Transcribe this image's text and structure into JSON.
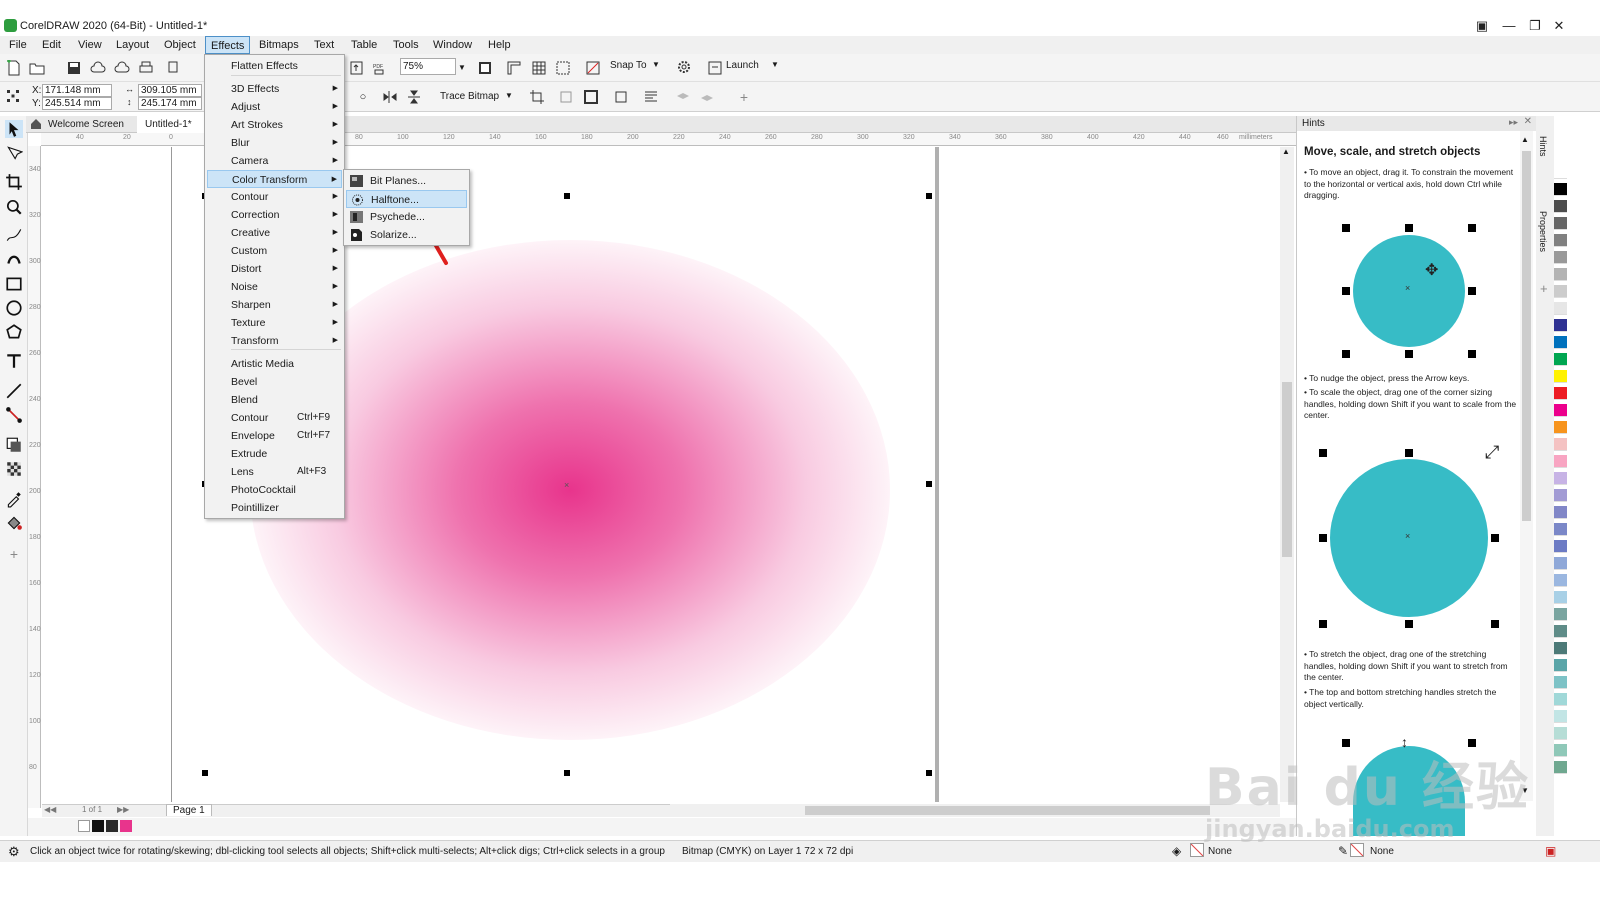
{
  "window": {
    "title": "CorelDRAW 2020 (64-Bit) - Untitled-1*"
  },
  "menubar": [
    "File",
    "Edit",
    "View",
    "Layout",
    "Object",
    "Effects",
    "Bitmaps",
    "Text",
    "Table",
    "Tools",
    "Window",
    "Help"
  ],
  "toolbar1": {
    "zoom": "75%",
    "snap_to": "Snap To",
    "launch": "Launch"
  },
  "toolbar2": {
    "x_label": "X:",
    "x": "171.148 mm",
    "y_label": "Y:",
    "y": "245.514 mm",
    "w": "309.105 mm",
    "h": "245.174 mm",
    "trace_bitmap": "Trace Bitmap"
  },
  "doc_tabs": [
    "Welcome Screen",
    "Untitled-1*"
  ],
  "ruler": {
    "h_ticks": [
      "40",
      "20",
      "0",
      "20",
      "40",
      "60",
      "80",
      "100",
      "120",
      "140",
      "160",
      "180",
      "200",
      "220",
      "240",
      "260",
      "280",
      "300",
      "320",
      "340",
      "360",
      "380",
      "400",
      "420",
      "440",
      "460"
    ],
    "unit": "millimeters",
    "v_ticks": [
      "340",
      "320",
      "300",
      "280",
      "260",
      "240",
      "220",
      "200",
      "180",
      "160",
      "140",
      "120",
      "100",
      "80",
      "60",
      "40",
      "20"
    ]
  },
  "effects_menu": {
    "items": [
      {
        "label": "Flatten Effects",
        "arrow": false
      },
      {
        "label": "3D Effects",
        "arrow": true
      },
      {
        "label": "Adjust",
        "arrow": true
      },
      {
        "label": "Art Strokes",
        "arrow": true
      },
      {
        "label": "Blur",
        "arrow": true
      },
      {
        "label": "Camera",
        "arrow": true
      },
      {
        "label": "Color Transform",
        "arrow": true
      },
      {
        "label": "Contour",
        "arrow": true
      },
      {
        "label": "Correction",
        "arrow": true
      },
      {
        "label": "Creative",
        "arrow": true
      },
      {
        "label": "Custom",
        "arrow": true
      },
      {
        "label": "Distort",
        "arrow": true
      },
      {
        "label": "Noise",
        "arrow": true
      },
      {
        "label": "Sharpen",
        "arrow": true
      },
      {
        "label": "Texture",
        "arrow": true
      },
      {
        "label": "Transform",
        "arrow": true
      },
      {
        "label": "Artistic Media",
        "shortcut": ""
      },
      {
        "label": "Bevel",
        "shortcut": ""
      },
      {
        "label": "Blend",
        "shortcut": ""
      },
      {
        "label": "Contour",
        "shortcut": "Ctrl+F9"
      },
      {
        "label": "Envelope",
        "shortcut": "Ctrl+F7"
      },
      {
        "label": "Extrude",
        "shortcut": ""
      },
      {
        "label": "Lens",
        "shortcut": "Alt+F3"
      },
      {
        "label": "PhotoCocktail",
        "shortcut": ""
      },
      {
        "label": "Pointillizer",
        "shortcut": ""
      }
    ]
  },
  "color_transform_submenu": [
    "Bit Planes...",
    "Halftone...",
    "Psychede...",
    "Solarize..."
  ],
  "page_nav": {
    "counter": "1 of 1",
    "page": "Page 1"
  },
  "hints": {
    "panel_title": "Hints",
    "heading": "Move, scale, and stretch objects",
    "p1": "• To move an object, drag it. To constrain the movement to the horizontal or vertical axis, hold down Ctrl while dragging.",
    "p2": "• To nudge the object, press the Arrow keys.",
    "p3": "• To scale the object, drag one of the corner sizing handles, holding down Shift if you want to scale from the center.",
    "p4": "• To stretch the object, drag one of the stretching handles, holding down Shift if you want to stretch from the center.",
    "p5": "• The top and bottom stretching handles stretch the object vertically.",
    "dock_tabs": [
      "Hints",
      "Properties"
    ]
  },
  "status": {
    "hint": "Click an object twice for rotating/skewing; dbl-clicking tool selects all objects; Shift+click multi-selects; Alt+click digs; Ctrl+click selects in a group",
    "object_info": "Bitmap (CMYK) on Layer 1 72 x 72 dpi",
    "fill": "None",
    "outline": "None"
  },
  "watermark": {
    "logo": "Bai du 经验",
    "url": "jingyan.baidu.com"
  },
  "colors": {
    "accent_teal": "#37bcc6",
    "blob_magenta": "#e8348c",
    "menu_highlight": "#cce4f7",
    "arrow_red": "#e0201e"
  },
  "palette": [
    "#ffffff",
    "#000000",
    "#4d4d4d",
    "#666666",
    "#808080",
    "#999999",
    "#b3b3b3",
    "#cccccc",
    "#e6e6e6",
    "#2e3192",
    "#0071bc",
    "#00a651",
    "#fff200",
    "#ed1c24",
    "#ec008c",
    "#f7941d",
    "#f4c2c2",
    "#f8a5c2",
    "#c7b3e5",
    "#a29bd4",
    "#8187c7",
    "#7b88c8",
    "#6c7bc4",
    "#8fa8d8",
    "#9bb7e0",
    "#a8d0e6",
    "#7aa5a0",
    "#5f8c88",
    "#4d7a78",
    "#5aa5a8",
    "#7dc2c6",
    "#a0d8d8",
    "#c2e5e5",
    "#b6ddd6",
    "#8fc8b8",
    "#6fa890"
  ]
}
